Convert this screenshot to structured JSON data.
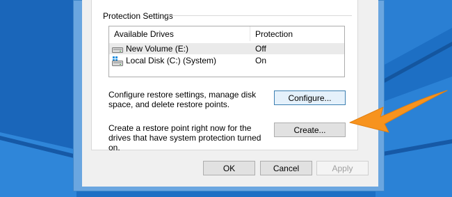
{
  "group": {
    "label": "Protection Settings"
  },
  "drives": {
    "columns": [
      "Available Drives",
      "Protection"
    ],
    "rows": [
      {
        "name": "New Volume (E:)",
        "protection": "Off",
        "icon": "drive-icon",
        "selected": true
      },
      {
        "name": "Local Disk (C:) (System)",
        "protection": "On",
        "icon": "system-drive-icon",
        "selected": false
      }
    ]
  },
  "configure": {
    "desc": "Configure restore settings, manage disk space, and delete restore points.",
    "button": "Configure..."
  },
  "create": {
    "desc": "Create a restore point right now for the drives that have system protection turned on.",
    "button": "Create..."
  },
  "footer": {
    "ok": "OK",
    "cancel": "Cancel",
    "apply": "Apply"
  },
  "colors": {
    "arrow": "#f7931e",
    "desktop": "#1e72c6",
    "focus": "#3c7fb1"
  }
}
